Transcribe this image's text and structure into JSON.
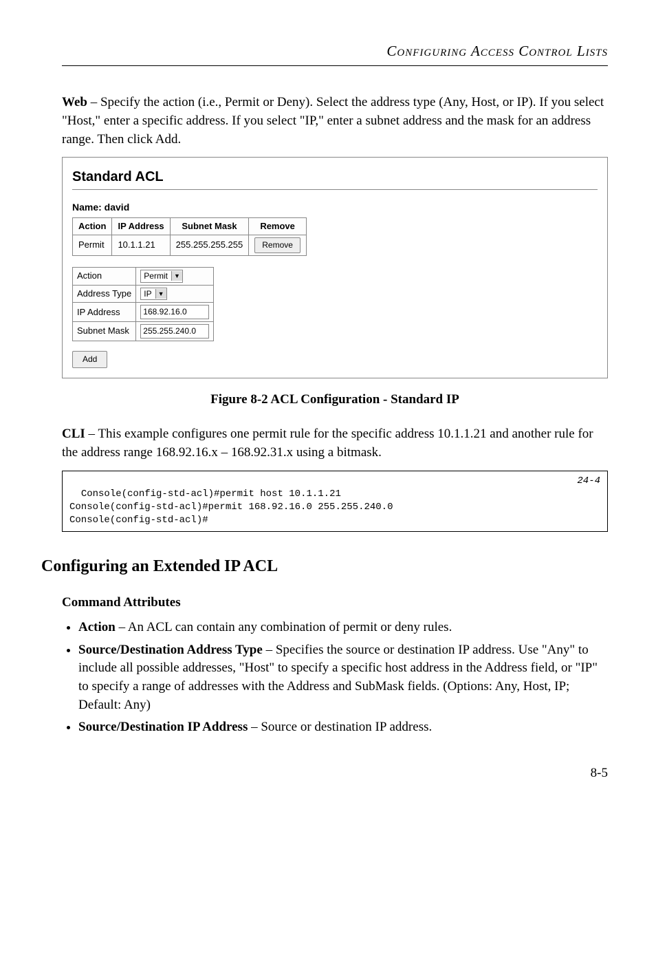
{
  "header": {
    "running_title": "Configuring Access Control Lists"
  },
  "intro": {
    "web_label": "Web",
    "web_text": " – Specify the action (i.e., Permit or Deny). Select the address type (Any, Host, or IP). If you select \"Host,\" enter a specific address. If you select \"IP,\" enter a subnet address and the mask for an address range. Then click Add."
  },
  "panel": {
    "title": "Standard ACL",
    "name_line": "Name: david",
    "table": {
      "headers": {
        "action": "Action",
        "ip": "IP Address",
        "mask": "Subnet Mask",
        "remove": "Remove"
      },
      "row": {
        "action": "Permit",
        "ip": "10.1.1.21",
        "mask": "255.255.255.255",
        "remove": "Remove"
      }
    },
    "form": {
      "labels": {
        "action": "Action",
        "addr_type": "Address Type",
        "ip": "IP Address",
        "mask": "Subnet Mask"
      },
      "values": {
        "action": "Permit",
        "addr_type": "IP",
        "ip": "168.92.16.0",
        "mask": "255.255.240.0"
      }
    },
    "add_btn": "Add"
  },
  "figure": {
    "caption": "Figure 8-2  ACL Configuration - Standard IP"
  },
  "cli": {
    "label": "CLI",
    "text": " – This example configures one permit rule for the specific address 10.1.1.21 and another rule for the address range 168.92.16.x – 168.92.31.x using a bitmask.",
    "code_ref": "24-4",
    "code": "Console(config-std-acl)#permit host 10.1.1.21\nConsole(config-std-acl)#permit 168.92.16.0 255.255.240.0\nConsole(config-std-acl)#"
  },
  "section": {
    "title": "Configuring an Extended IP ACL",
    "subheading": "Command Attributes",
    "bullets": {
      "b1_label": "Action",
      "b1_text": " – An ACL can contain any combination of permit or deny rules.",
      "b2_label": "Source/Destination Address Type",
      "b2_text": " – Specifies the source or destination IP address. Use \"Any\" to include all possible addresses, \"Host\" to specify a specific host address in the Address field, or \"IP\" to specify a range of addresses with the Address and SubMask fields. (Options: Any, Host, IP; Default: Any)",
      "b3_label": "Source/Destination IP Address",
      "b3_text": " – Source or destination IP address."
    }
  },
  "page_num": "8-5"
}
